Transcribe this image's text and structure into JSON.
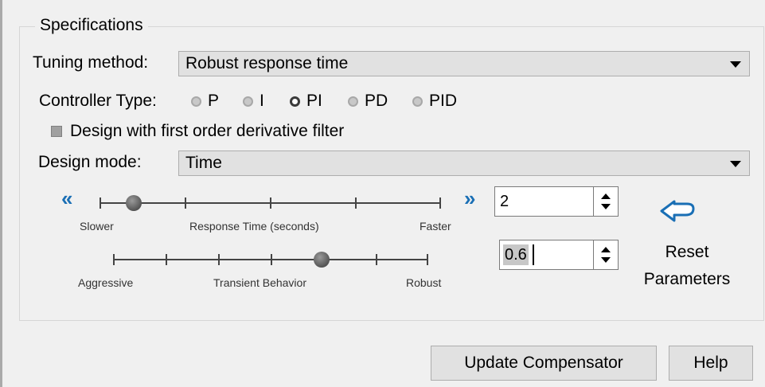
{
  "specifications": {
    "title": "Specifications",
    "tuning_method_label": "Tuning method:",
    "tuning_method_value": "Robust response time",
    "controller_type_label": "Controller Type:",
    "controller_types": [
      {
        "label": "P",
        "selected": false
      },
      {
        "label": "I",
        "selected": false
      },
      {
        "label": "PI",
        "selected": true
      },
      {
        "label": "PD",
        "selected": false
      },
      {
        "label": "PID",
        "selected": false
      }
    ],
    "derivative_filter_label": "Design with first order derivative filter",
    "derivative_filter_checked": false,
    "design_mode_label": "Design mode:",
    "design_mode_value": "Time"
  },
  "response_time": {
    "left_label": "Slower",
    "center_label": "Response Time (seconds)",
    "right_label": "Faster",
    "value": "2",
    "left_arrow": "«",
    "right_arrow": "»"
  },
  "transient": {
    "left_label": "Aggressive",
    "center_label": "Transient Behavior",
    "right_label": "Robust",
    "value": "0.6"
  },
  "reset": {
    "line1": "Reset",
    "line2": "Parameters"
  },
  "buttons": {
    "update": "Update Compensator",
    "help": "Help"
  }
}
